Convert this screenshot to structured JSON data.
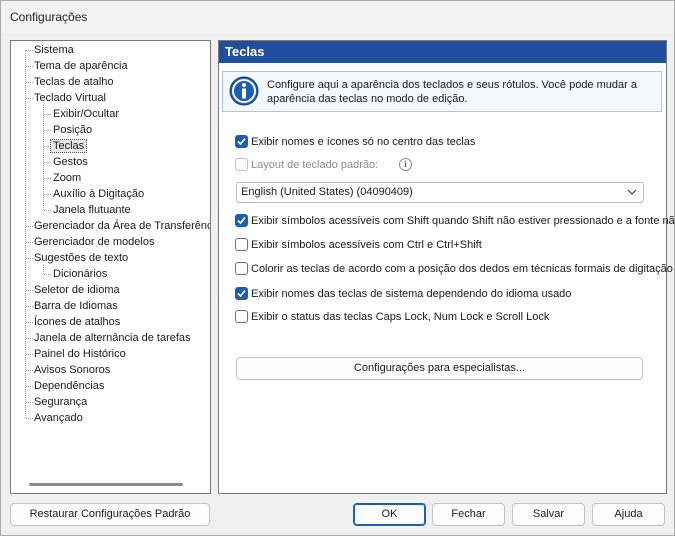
{
  "window": {
    "title": "Configurações"
  },
  "tree": {
    "items": [
      {
        "label": "Sistema",
        "level": 0
      },
      {
        "label": "Tema de aparência",
        "level": 0
      },
      {
        "label": "Teclas de atalho",
        "level": 0
      },
      {
        "label": "Teclado Virtual",
        "level": 0
      },
      {
        "label": "Exibir/Ocultar",
        "level": 1
      },
      {
        "label": "Posição",
        "level": 1
      },
      {
        "label": "Teclas",
        "level": 1,
        "selected": true
      },
      {
        "label": "Gestos",
        "level": 1
      },
      {
        "label": "Zoom",
        "level": 1
      },
      {
        "label": "Auxílio à Digitação",
        "level": 1
      },
      {
        "label": "Janela flutuante",
        "level": 1
      },
      {
        "label": "Gerenciador da Área de Transferência",
        "level": 0
      },
      {
        "label": "Gerenciador de modelos",
        "level": 0
      },
      {
        "label": "Sugestões de texto",
        "level": 0
      },
      {
        "label": "Dicionários",
        "level": 1
      },
      {
        "label": "Seletor de idioma",
        "level": 0
      },
      {
        "label": "Barra de Idiomas",
        "level": 0
      },
      {
        "label": "Ícones de atalhos",
        "level": 0
      },
      {
        "label": "Janela de alternância de tarefas",
        "level": 0
      },
      {
        "label": "Painel do Histórico",
        "level": 0
      },
      {
        "label": "Avisos Sonoros",
        "level": 0
      },
      {
        "label": "Dependências",
        "level": 0
      },
      {
        "label": "Segurança",
        "level": 0
      },
      {
        "label": "Avançado",
        "level": 0
      }
    ]
  },
  "panel": {
    "header": "Teclas",
    "info": "Configure aqui a aparência dos teclados e seus rótulos. Você pode mudar a aparência das teclas no modo de edição.",
    "options": {
      "show_names_center": {
        "label": "Exibir nomes e ícones só no centro das teclas",
        "checked": true
      },
      "default_layout": {
        "label": "Layout de teclado padrão:",
        "checked": false,
        "disabled": true
      },
      "shift_symbols": {
        "label": "Exibir símbolos acessíveis com Shift quando Shift não estiver pressionado e a fonte não",
        "checked": true
      },
      "ctrl_symbols": {
        "label": "Exibir símbolos acessíveis com Ctrl e Ctrl+Shift",
        "checked": false
      },
      "color_fingers": {
        "label": "Colorir as teclas de acordo com a posição dos dedos em técnicas formais de digitação",
        "checked": false
      },
      "system_key_names": {
        "label": "Exibir nomes das teclas de sistema dependendo do idioma usado",
        "checked": true
      },
      "lock_status": {
        "label": "Exibir o status das teclas Caps Lock, Num Lock e Scroll Lock",
        "checked": false
      }
    },
    "layout_select": {
      "value": "English (United States) (04090409)"
    },
    "expert_button": "Configurações para especialistas..."
  },
  "footer": {
    "restore": "Restaurar Configurações Padrão",
    "ok": "OK",
    "close": "Fechar",
    "save": "Salvar",
    "help": "Ajuda"
  },
  "colors": {
    "header_bg": "#1f4e9e",
    "checkbox_checked": "#1a5fb4",
    "info_icon": "#1a5fb4"
  },
  "icons": {
    "info": "info-icon",
    "help": "question-icon",
    "chevron": "chevron-down-icon"
  }
}
